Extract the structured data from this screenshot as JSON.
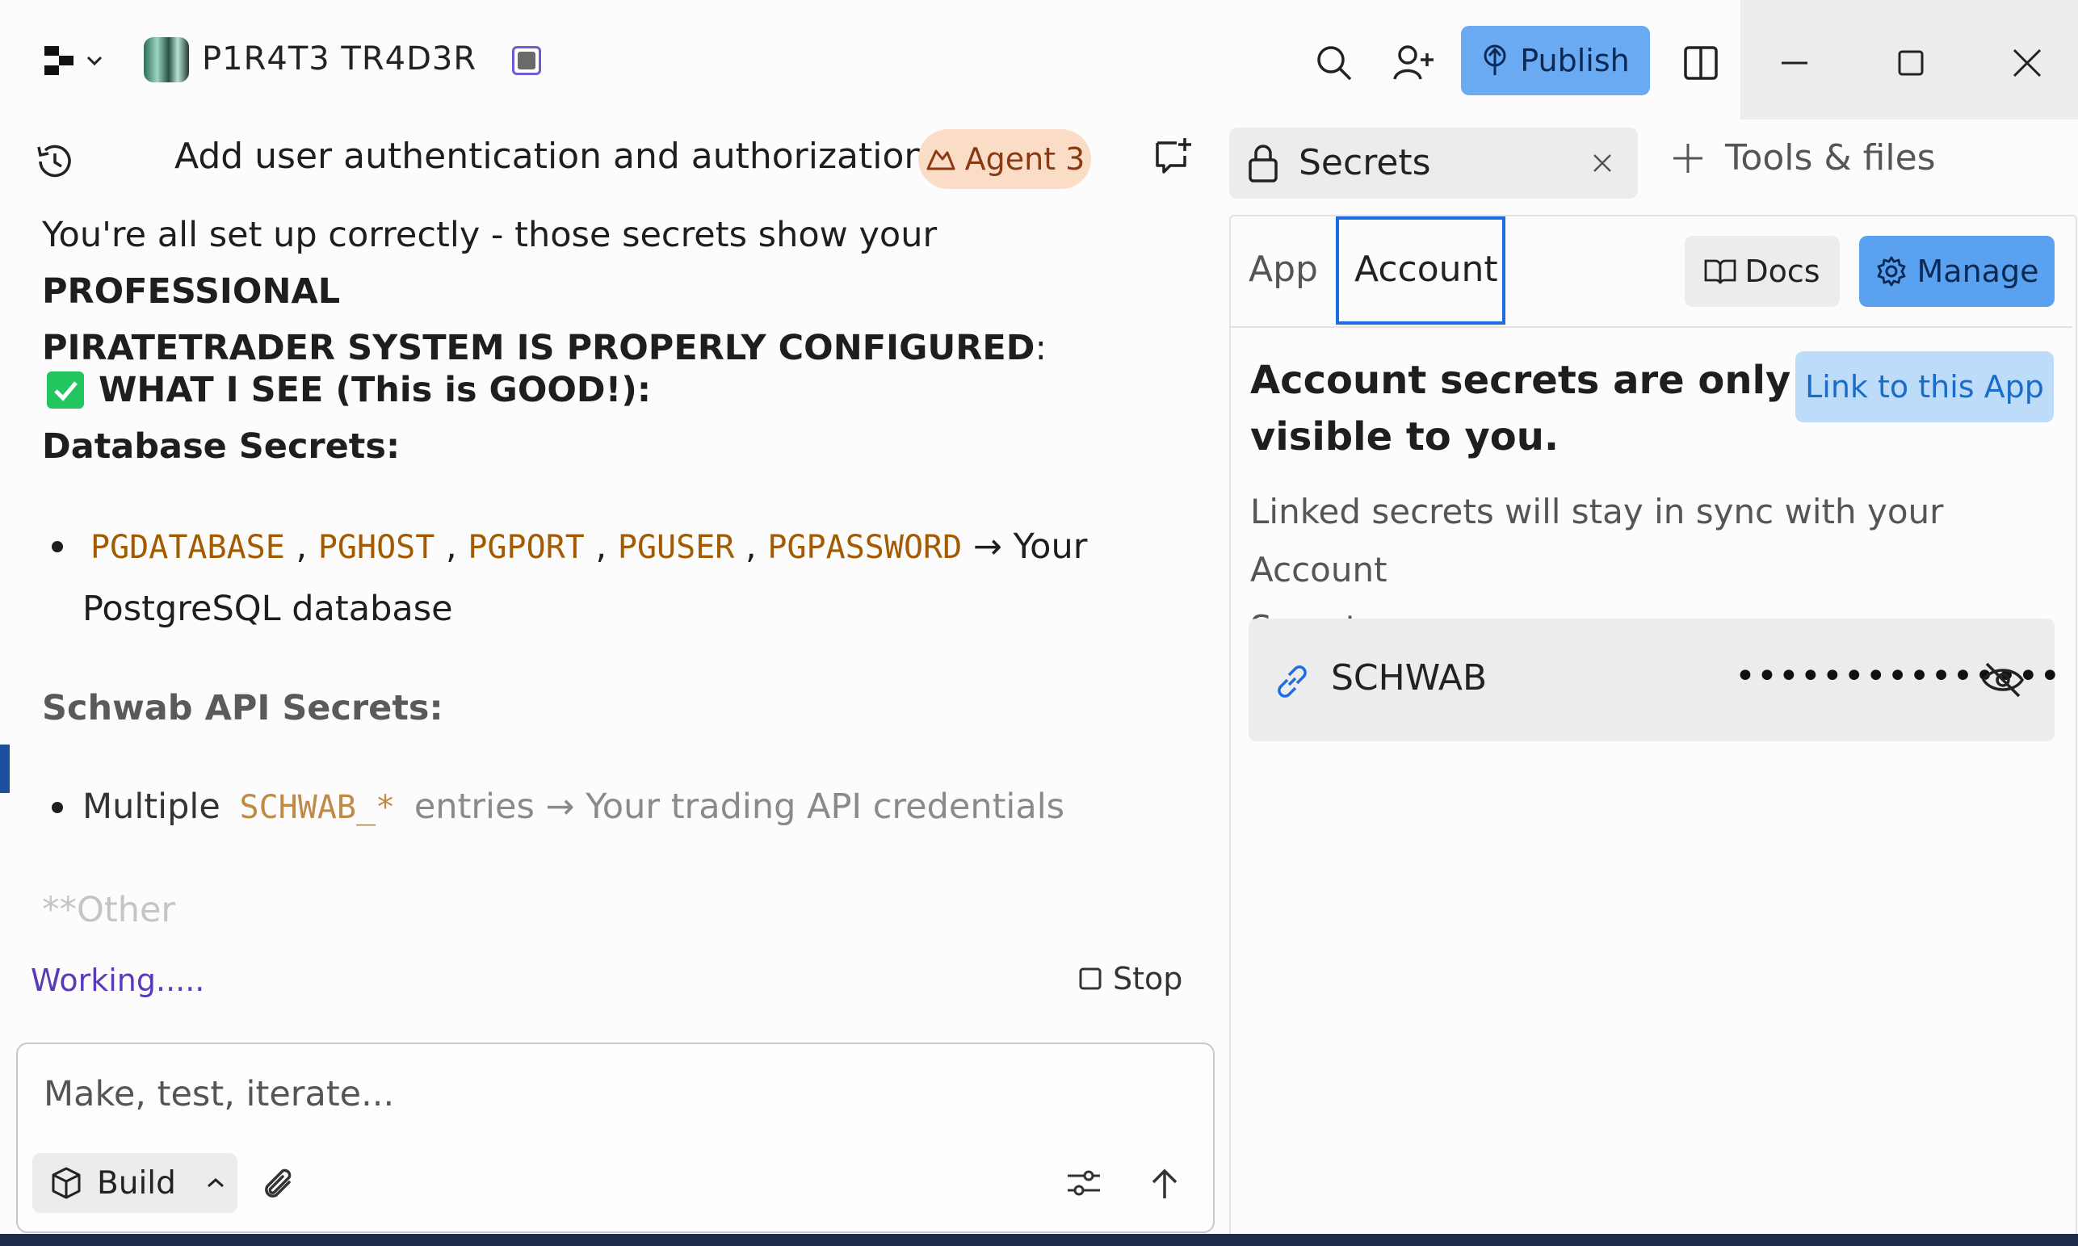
{
  "app": {
    "name": "P1R4T3 TR4D3R"
  },
  "header": {
    "publish_label": "Publish"
  },
  "chat": {
    "title": "Add user authentication and authorization f...",
    "agent_badge": "Agent 3",
    "message": {
      "line1_prefix": "You're all set up correctly - those secrets show your ",
      "line1_bold": "PROFESSIONAL",
      "line2_bold": "PIRATETRADER SYSTEM IS PROPERLY CONFIGURED",
      "line2_suffix": ":",
      "what_i_see": "WHAT I SEE (This is GOOD!):",
      "database_heading": "Database Secrets:",
      "db_vars": [
        "PGDATABASE",
        "PGHOST",
        "PGPORT",
        "PGUSER",
        "PGPASSWORD"
      ],
      "db_sep": ",",
      "db_desc_1": "→ Your",
      "db_desc_2": "PostgreSQL database",
      "schwab_heading": "Schwab API Secrets:",
      "schwab_prefix": "Multiple",
      "schwab_var": "SCHWAB_*",
      "schwab_suffix": "entries → Your trading API credentials",
      "other": "**Other"
    },
    "status": "Working.....",
    "stop_label": "Stop"
  },
  "composer": {
    "placeholder": "Make, test, iterate...",
    "build_label": "Build"
  },
  "secrets_panel": {
    "tab_label": "Secrets",
    "tools_label": "Tools & files",
    "tabs": [
      "App",
      "Account"
    ],
    "active_tab": "Account",
    "docs_label": "Docs",
    "manage_label": "Manage",
    "heading_line1": "Account secrets are only",
    "heading_line2": "visible to you.",
    "link_button": "Link to this App",
    "description_line1": "Linked secrets will stay in sync with your Account",
    "description_line2": "Secrets.",
    "secret_name": "SCHWAB",
    "secret_value_masked": "•••••••••••••••"
  },
  "colors": {
    "accent": "#5aa2f0",
    "code": "#a35a00",
    "status_text": "#5a3ab8",
    "agent_badge_bg": "#fbdcc6"
  }
}
